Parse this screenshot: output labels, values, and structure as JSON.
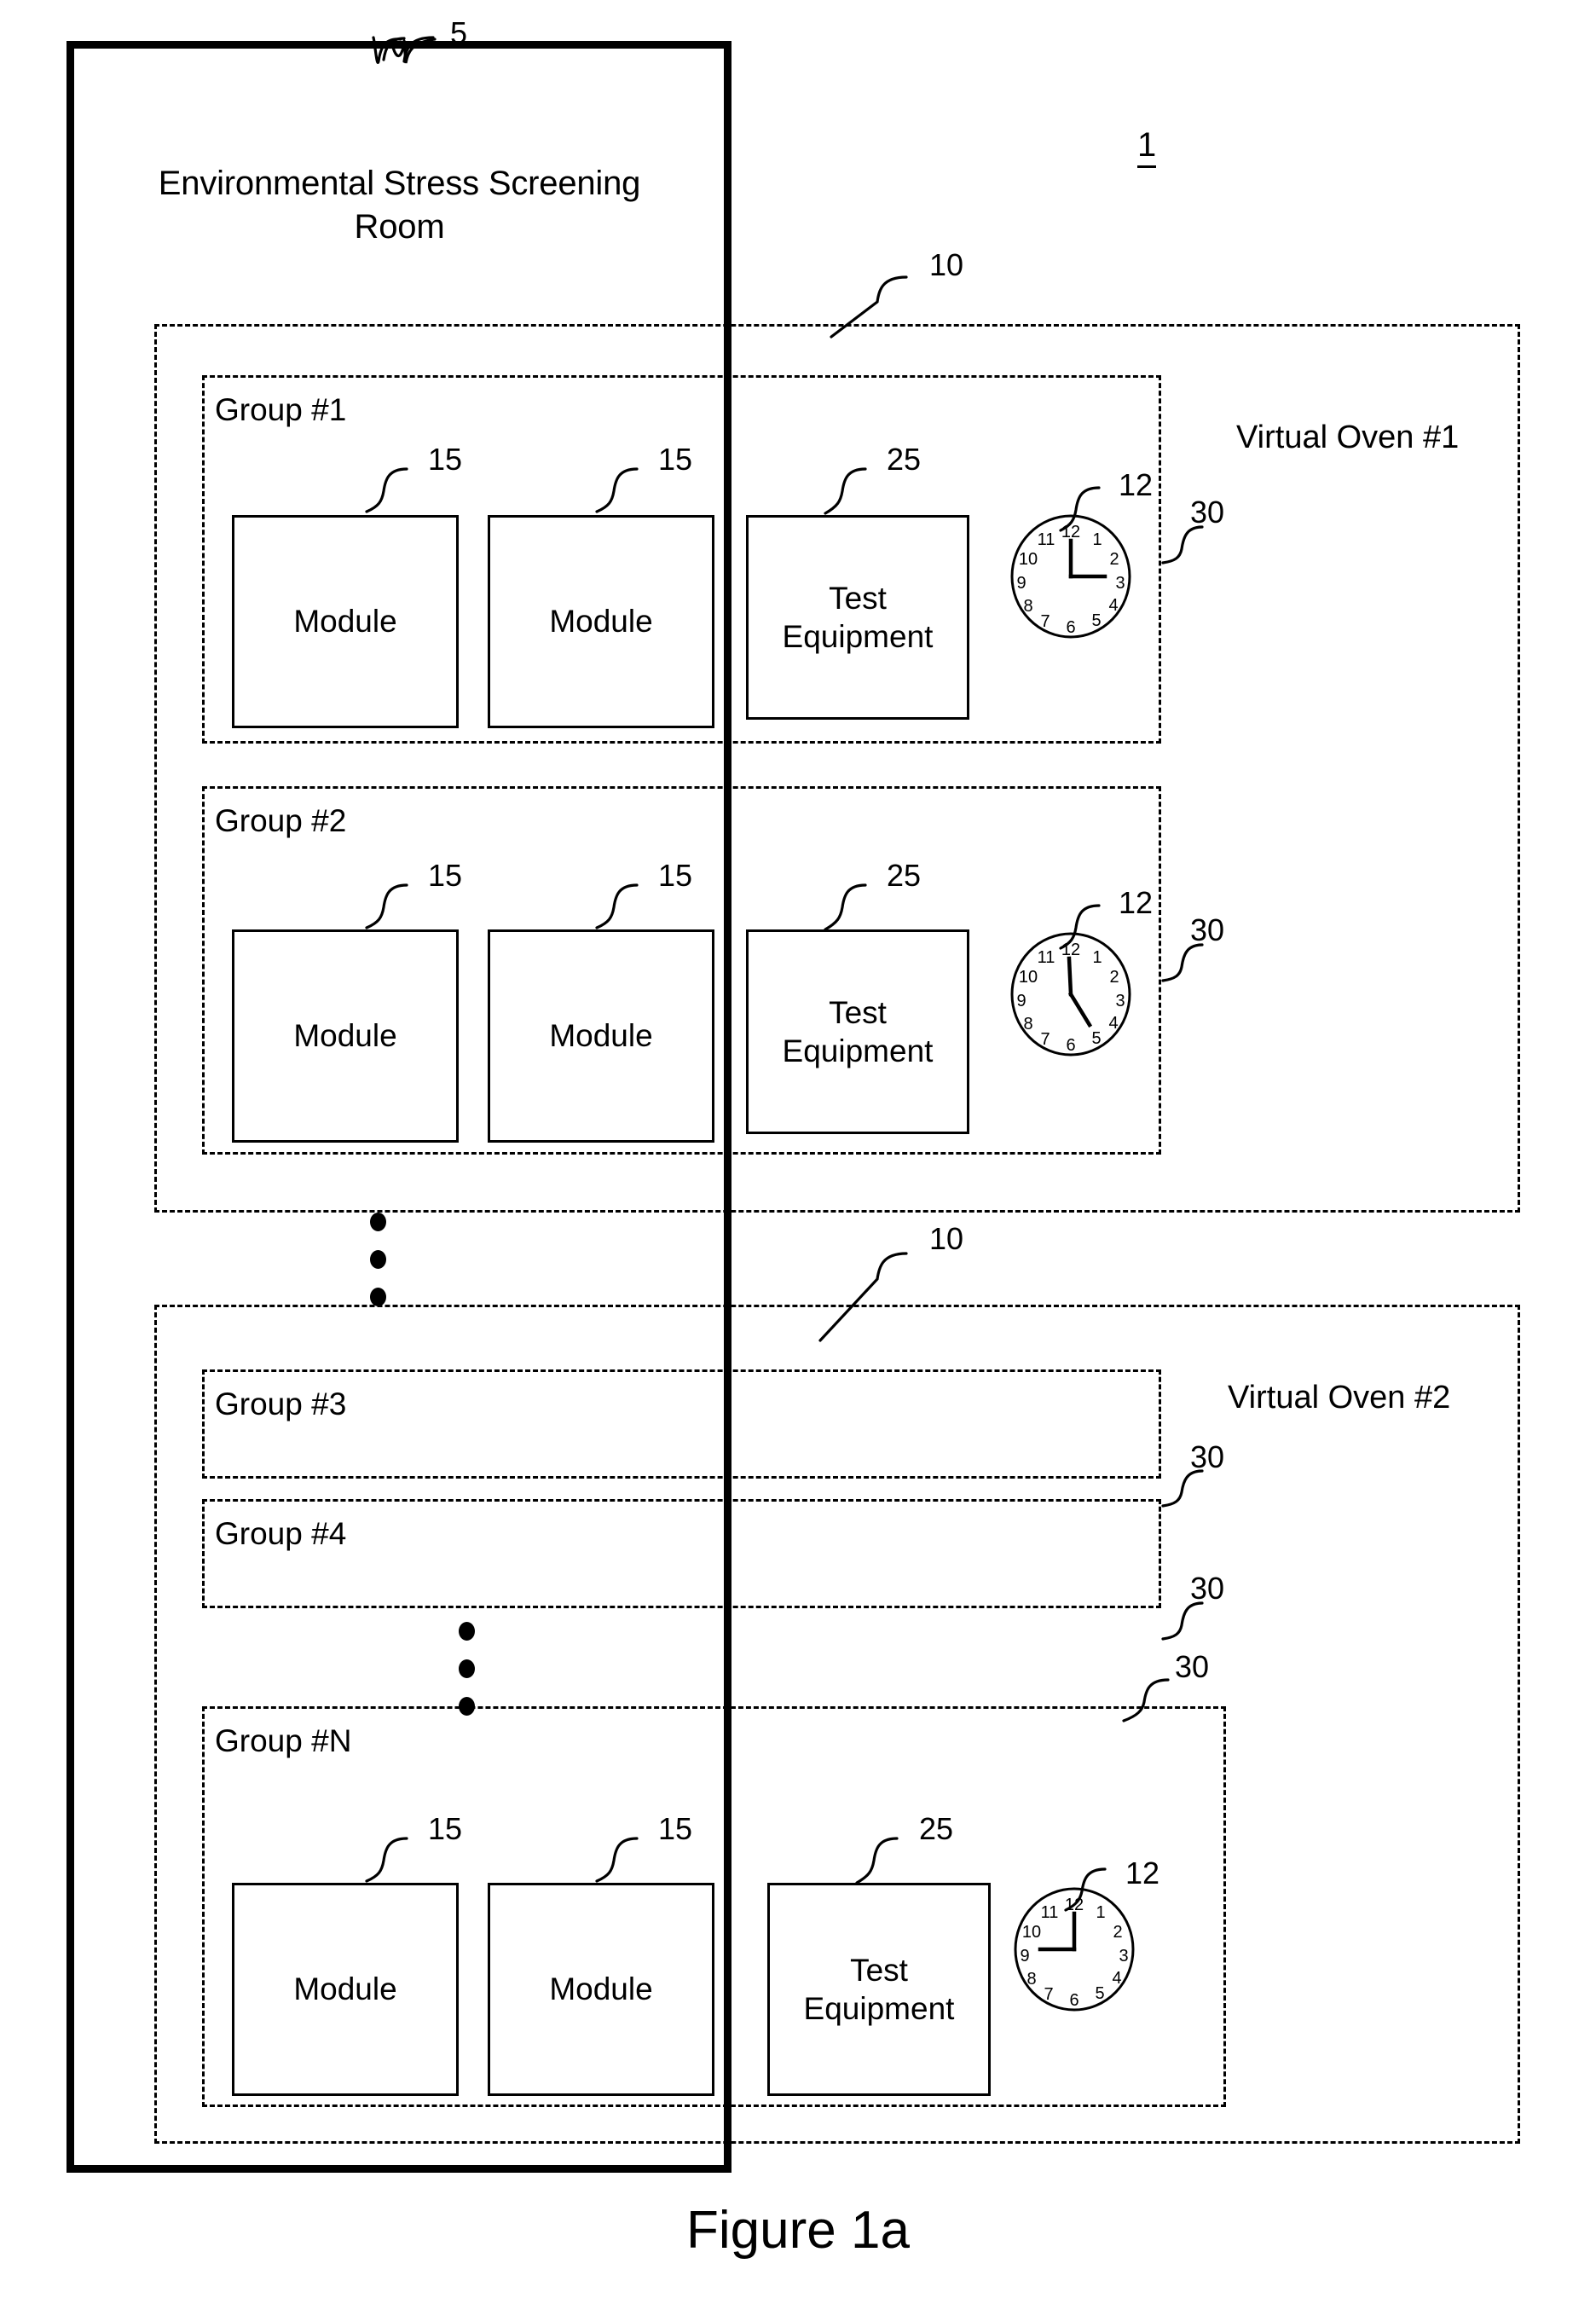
{
  "figure": {
    "caption": "Figure 1a",
    "system_ref": "1"
  },
  "room": {
    "label": "Environmental Stress Screening\nRoom",
    "label_line1": "Environmental Stress Screening",
    "label_line2": "Room",
    "ref": "5"
  },
  "ovens": [
    {
      "label": "Virtual Oven #1",
      "ref": "10",
      "groups": [
        {
          "label": "Group #1",
          "ref": "30",
          "nodes": [
            {
              "type": "module",
              "label": "Module",
              "ref": "15"
            },
            {
              "type": "module",
              "label": "Module",
              "ref": "15"
            },
            {
              "type": "test-equipment",
              "label": "Test\nEquipment",
              "label_line1": "Test",
              "label_line2": "Equipment",
              "ref": "25"
            }
          ],
          "clock": {
            "ref": "12",
            "hour_deg": 90,
            "minute_deg": 0,
            "time": "12:15"
          }
        },
        {
          "label": "Group #2",
          "ref": "30",
          "nodes": [
            {
              "type": "module",
              "label": "Module",
              "ref": "15"
            },
            {
              "type": "module",
              "label": "Module",
              "ref": "15"
            },
            {
              "type": "test-equipment",
              "label": "Test\nEquipment",
              "label_line1": "Test",
              "label_line2": "Equipment",
              "ref": "25"
            }
          ],
          "clock": {
            "ref": "12",
            "hour_deg": 150,
            "minute_deg": 0,
            "time": "12:25"
          }
        }
      ]
    },
    {
      "label": "Virtual Oven #2",
      "ref": "10",
      "groups": [
        {
          "label": "Group #3",
          "ref": "30",
          "nodes": [],
          "clock": null
        },
        {
          "label": "Group #4",
          "ref": "30",
          "nodes": [],
          "clock": null
        },
        {
          "label": "Group #N",
          "ref": "30",
          "nodes": [
            {
              "type": "module",
              "label": "Module",
              "ref": "15"
            },
            {
              "type": "module",
              "label": "Module",
              "ref": "15"
            },
            {
              "type": "test-equipment",
              "label": "Test\nEquipment",
              "label_line1": "Test",
              "label_line2": "Equipment",
              "ref": "25"
            }
          ],
          "clock": {
            "ref": "12",
            "hour_deg": 270,
            "minute_deg": 0,
            "time": "12:45"
          }
        }
      ]
    }
  ],
  "clock_face_numerals": [
    "12",
    "1",
    "2",
    "3",
    "4",
    "5",
    "6",
    "7",
    "8",
    "9",
    "10",
    "11"
  ],
  "ellipsis": {
    "between_ovens": "•••",
    "between_groups": "•••"
  },
  "colors": {
    "ink": "#000000",
    "background": "#ffffff"
  }
}
